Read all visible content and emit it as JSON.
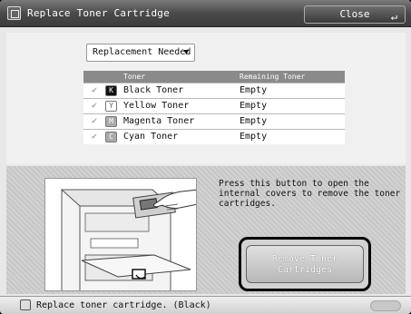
{
  "title_bar": {
    "title": "Replace Toner Cartridge",
    "close_label": "Close",
    "close_icon": "return-arrow-icon"
  },
  "filter": {
    "selected": "Replacement Needed"
  },
  "toner_table": {
    "headers": {
      "toner": "Toner",
      "remaining": "Remaining Toner"
    },
    "rows": [
      {
        "badge": "K",
        "name": "Black Toner",
        "remaining": "Empty",
        "badge_style": "dark"
      },
      {
        "badge": "Y",
        "name": "Yellow Toner",
        "remaining": "Empty",
        "badge_style": "light"
      },
      {
        "badge": "M",
        "name": "Magenta Toner",
        "remaining": "Empty",
        "badge_style": "grey"
      },
      {
        "badge": "C",
        "name": "Cyan Toner",
        "remaining": "Empty",
        "badge_style": "grey"
      }
    ]
  },
  "instruction": "Press this button to open the internal covers to remove the toner cartridges.",
  "remove_button": {
    "line1": "Remove Toner",
    "line2": "Cartridges"
  },
  "status_bar": {
    "message": "Replace toner cartridge. (Black)"
  }
}
